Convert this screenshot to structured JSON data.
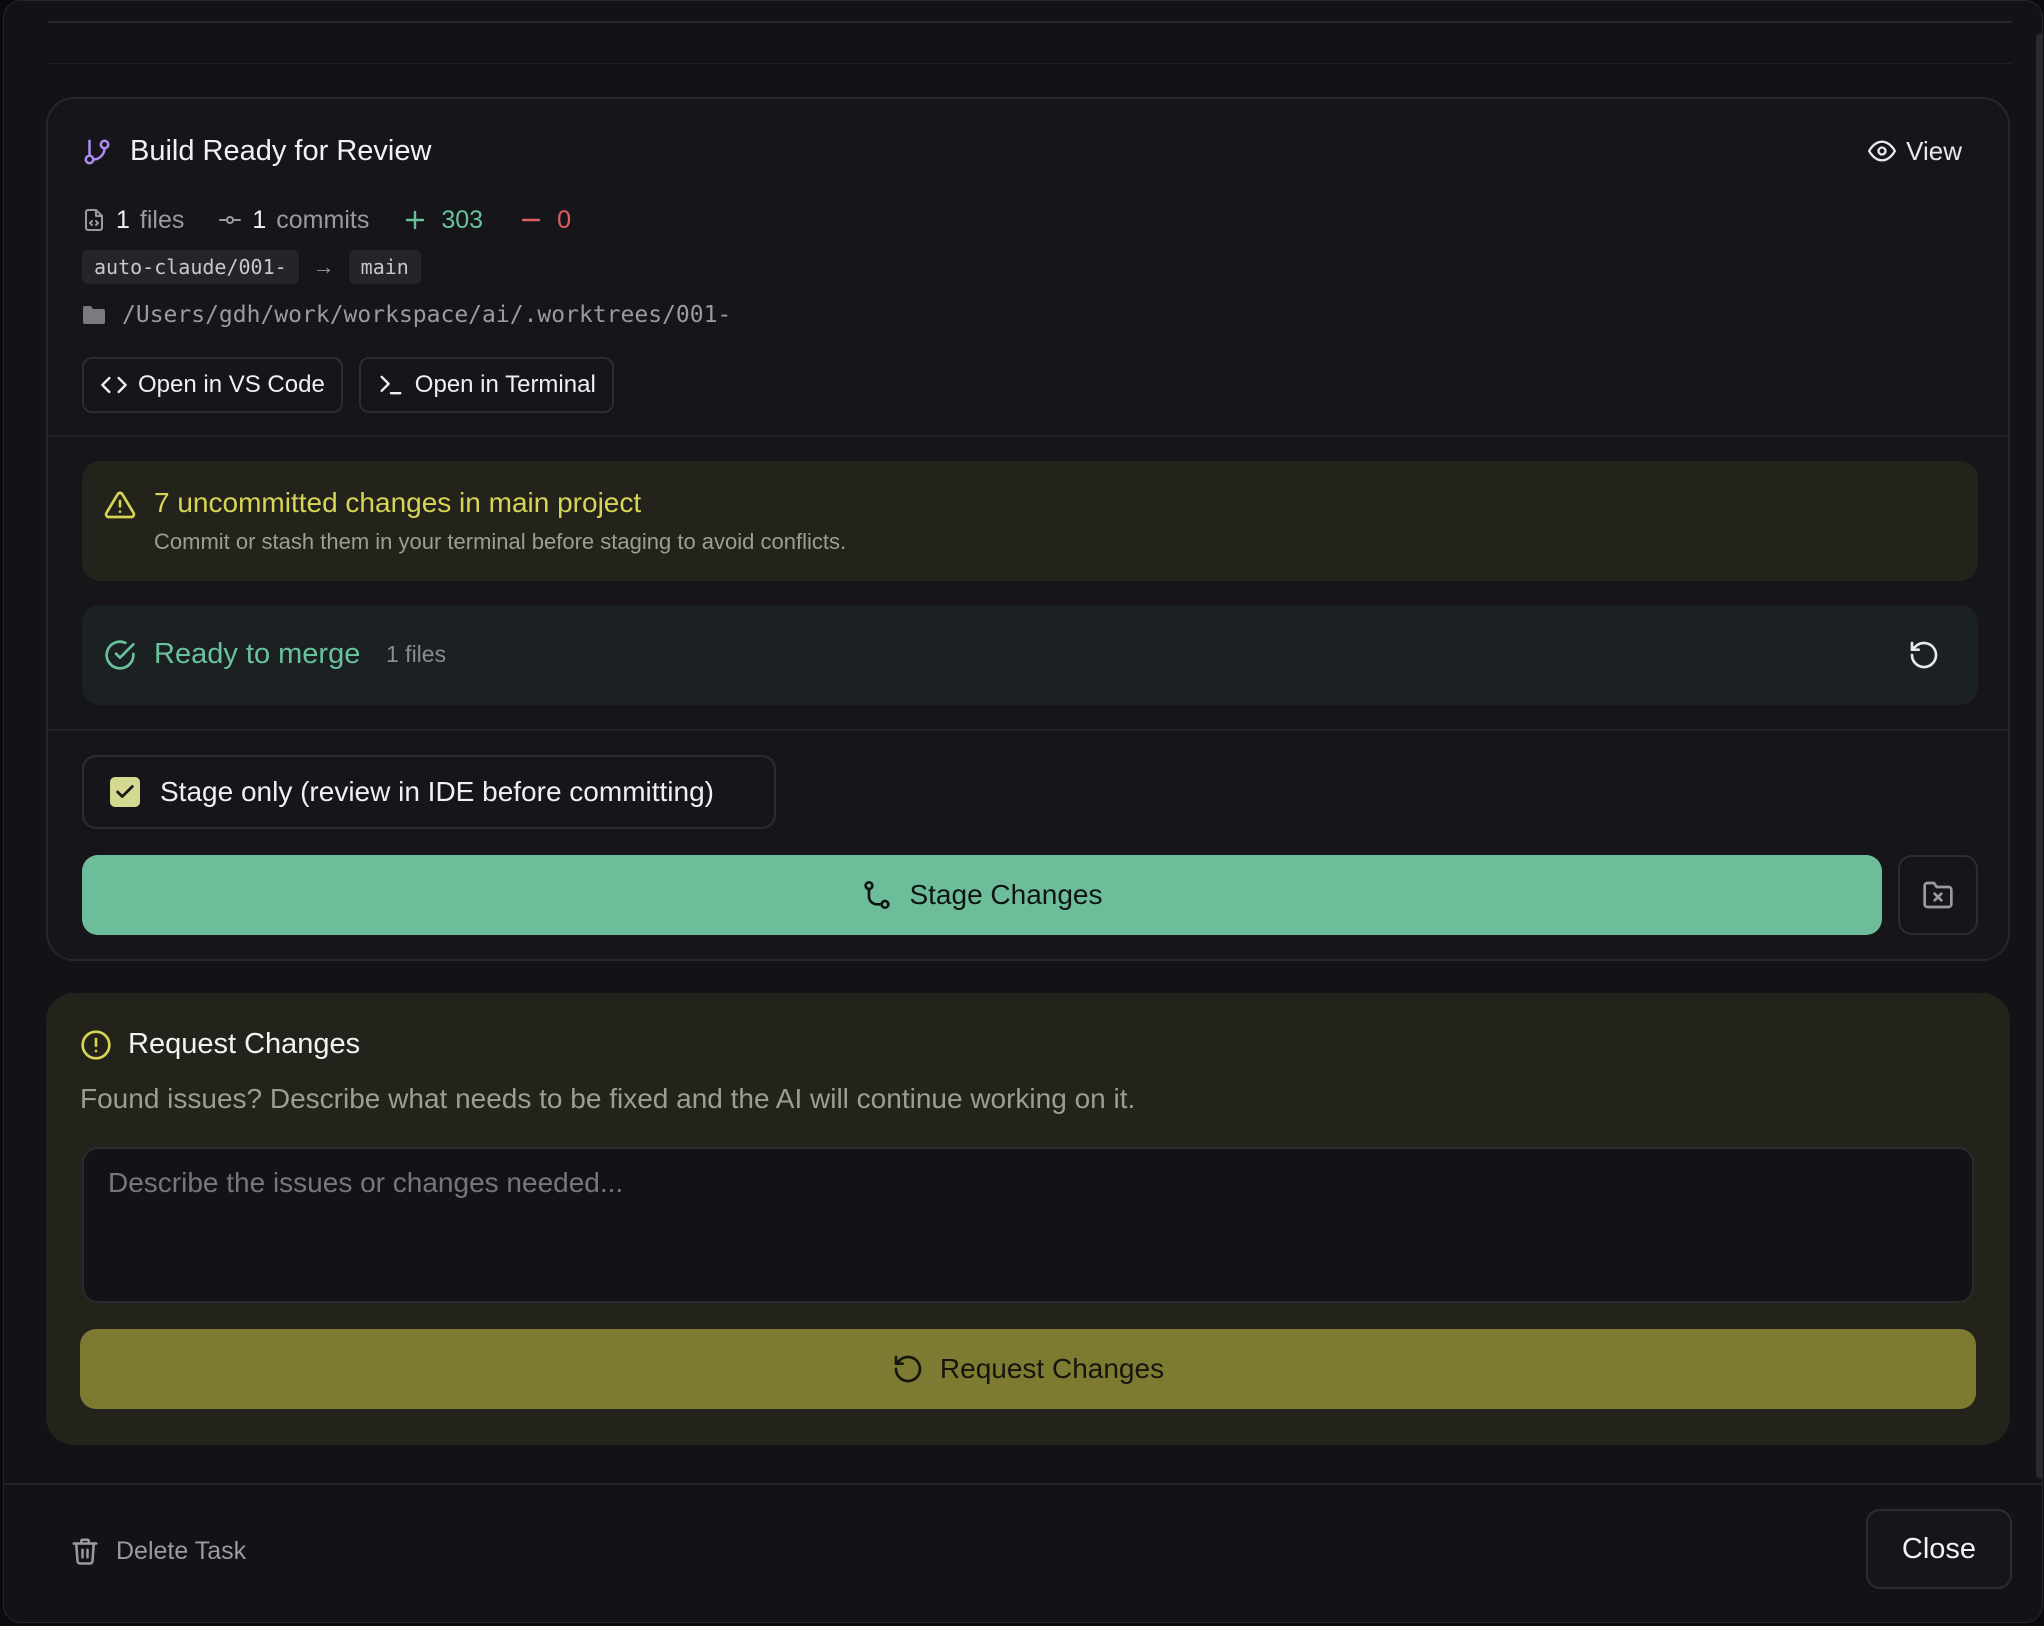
{
  "review": {
    "title": "Build Ready for Review",
    "view_label": "View",
    "stats": {
      "files_count": "1",
      "files_label": "files",
      "commits_count": "1",
      "commits_label": "commits",
      "additions": "303",
      "deletions": "0"
    },
    "source_branch": "auto-claude/001-",
    "target_branch": "main",
    "worktree_path": "/Users/gdh/work/workspace/ai/.worktrees/001-",
    "open_vscode_label": "Open in VS Code",
    "open_terminal_label": "Open in Terminal"
  },
  "warning": {
    "title": "7 uncommitted changes in main project",
    "subtitle": "Commit or stash them in your terminal before staging to avoid conflicts."
  },
  "merge_status": {
    "title": "Ready to merge",
    "files": "1 files"
  },
  "stage": {
    "checkbox_label": "Stage only (review in IDE before committing)",
    "checked": true,
    "button_label": "Stage Changes"
  },
  "request_changes": {
    "title": "Request Changes",
    "description": "Found issues? Describe what needs to be fixed and the AI will continue working on it.",
    "placeholder": "Describe the issues or changes needed...",
    "button_label": "Request Changes"
  },
  "footer": {
    "delete_label": "Delete Task",
    "close_label": "Close"
  },
  "colors": {
    "accent_green": "#6ebd9a",
    "accent_olive": "#7c7b31",
    "warning_yellow": "#d8d454",
    "branch_purple": "#b08cf0",
    "deletion_red": "#e06060"
  },
  "icons": [
    "git-branch-icon",
    "eye-icon",
    "file-code-icon",
    "git-commit-icon",
    "plus-icon",
    "minus-icon",
    "arrow-right-icon",
    "folder-icon",
    "code-icon",
    "terminal-icon",
    "alert-triangle-icon",
    "check-circle-icon",
    "refresh-icon",
    "check-icon",
    "git-merge-icon",
    "folder-x-icon",
    "alert-circle-icon",
    "rotate-ccw-icon",
    "trash-icon"
  ]
}
